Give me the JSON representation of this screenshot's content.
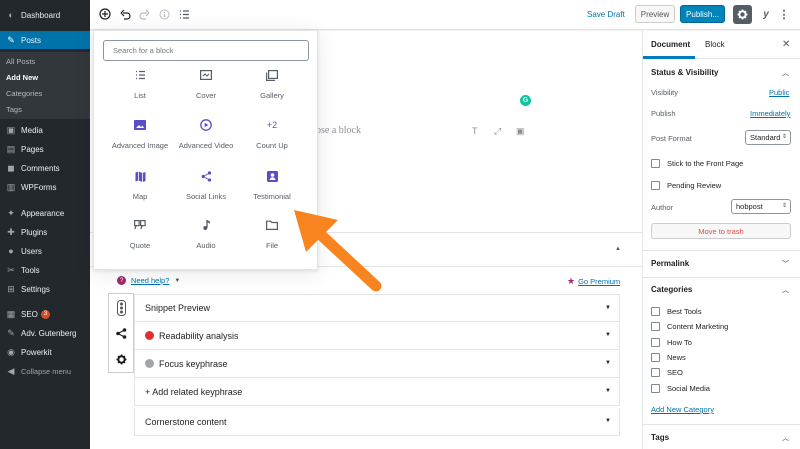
{
  "admin_menu": {
    "items": [
      {
        "label": "Dashboard",
        "icon": "dashboard-icon",
        "glyph": "◐"
      },
      {
        "label": "Posts",
        "icon": "pin-icon",
        "glyph": "✎"
      },
      {
        "label": "Media",
        "icon": "media-icon",
        "glyph": "▣"
      },
      {
        "label": "Pages",
        "icon": "pages-icon",
        "glyph": "▤"
      },
      {
        "label": "Comments",
        "icon": "comments-icon",
        "glyph": "◼"
      },
      {
        "label": "WPForms",
        "icon": "wpforms-icon",
        "glyph": "▥"
      },
      {
        "label": "Appearance",
        "icon": "appearance-icon",
        "glyph": "✦"
      },
      {
        "label": "Plugins",
        "icon": "plugins-icon",
        "glyph": "✚"
      },
      {
        "label": "Users",
        "icon": "users-icon",
        "glyph": "●"
      },
      {
        "label": "Tools",
        "icon": "tools-icon",
        "glyph": "✂"
      },
      {
        "label": "Settings",
        "icon": "settings-icon",
        "glyph": "⊞"
      },
      {
        "label": "SEO",
        "icon": "seo-icon",
        "glyph": "▦",
        "badge": "3"
      },
      {
        "label": "Adv. Gutenberg",
        "icon": "adv-gutenberg-icon",
        "glyph": "✎"
      },
      {
        "label": "Powerkit",
        "icon": "powerkit-icon",
        "glyph": "◉"
      },
      {
        "label": "Collapse menu",
        "icon": "collapse-icon",
        "glyph": "◀"
      }
    ],
    "posts_submenu": [
      "All Posts",
      "Add New",
      "Categories",
      "Tags"
    ]
  },
  "toolbar": {
    "save_draft": "Save Draft",
    "preview": "Preview",
    "publish": "Publish..."
  },
  "inserter": {
    "search_placeholder": "Search for a block",
    "blocks": [
      {
        "label": "List",
        "icon": "list-icon"
      },
      {
        "label": "Cover",
        "icon": "cover-icon"
      },
      {
        "label": "Gallery",
        "icon": "gallery-icon"
      },
      {
        "label": "Advanced Image",
        "icon": "advanced-image-icon"
      },
      {
        "label": "Advanced Video",
        "icon": "advanced-video-icon"
      },
      {
        "label": "Count Up",
        "icon": "count-up-icon",
        "glyph": "+2"
      },
      {
        "label": "Map",
        "icon": "map-icon"
      },
      {
        "label": "Social Links",
        "icon": "share-icon"
      },
      {
        "label": "Testimonial",
        "icon": "testimonial-icon"
      },
      {
        "label": "Quote",
        "icon": "quote-icon"
      },
      {
        "label": "Audio",
        "icon": "audio-icon"
      },
      {
        "label": "File",
        "icon": "file-icon"
      }
    ]
  },
  "canvas": {
    "placeholder_fragment": "ose a block"
  },
  "yoast": {
    "need_help": "Need help?",
    "go_premium": "Go Premium",
    "rows": [
      {
        "label": "Snippet Preview"
      },
      {
        "label": "Readability analysis",
        "dot": "#dc3232"
      },
      {
        "label": "Focus keyphrase",
        "dot": "#a0a5aa"
      },
      {
        "label": "+ Add related keyphrase"
      },
      {
        "label": "Cornerstone content"
      }
    ]
  },
  "sidebar": {
    "tabs": {
      "document": "Document",
      "block": "Block"
    },
    "status_visibility": {
      "title": "Status & Visibility",
      "visibility_label": "Visibility",
      "visibility_value": "Public",
      "publish_label": "Publish",
      "publish_value": "Immediately",
      "post_format_label": "Post Format",
      "post_format_value": "Standard",
      "sticky_label": "Stick to the Front Page",
      "pending_label": "Pending Review",
      "author_label": "Author",
      "author_value": "hobpost",
      "trash": "Move to trash"
    },
    "permalink": {
      "title": "Permalink"
    },
    "categories": {
      "title": "Categories",
      "items": [
        "Best Tools",
        "Content Marketing",
        "How To",
        "News",
        "SEO",
        "Social Media"
      ],
      "add_new": "Add New Category"
    },
    "tags": {
      "title": "Tags"
    }
  },
  "colors": {
    "accent": "#0073aa",
    "publish": "#0085ba",
    "arrow": "#f7841e",
    "admin_bg": "#23282d"
  }
}
